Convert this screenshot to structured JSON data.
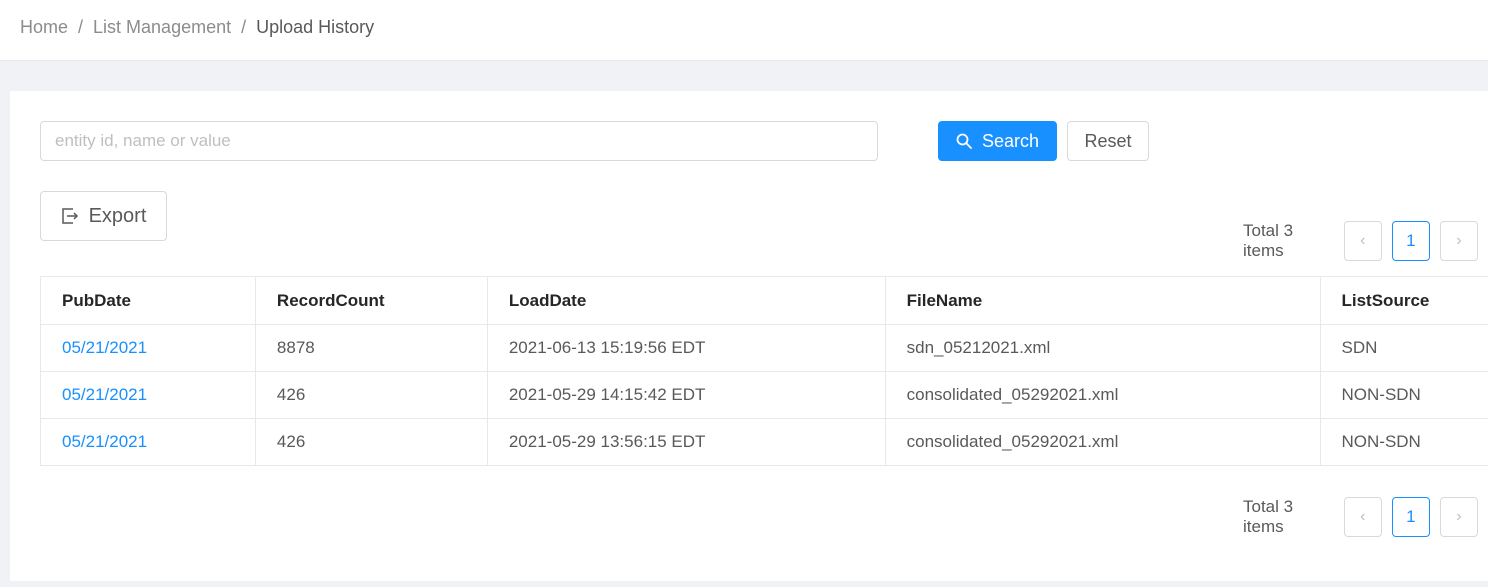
{
  "breadcrumb": {
    "home": "Home",
    "separator": "/",
    "list_management": "List Management",
    "current": "Upload History"
  },
  "search": {
    "placeholder": "entity id, name or value",
    "value": "",
    "search_label": "Search",
    "reset_label": "Reset"
  },
  "toolbar": {
    "export_label": "Export"
  },
  "pagination": {
    "total_text": "Total 3 items",
    "prev_icon": "‹",
    "next_icon": "›",
    "current_page": "1"
  },
  "table": {
    "columns": [
      "PubDate",
      "RecordCount",
      "LoadDate",
      "FileName",
      "ListSource"
    ],
    "rows": [
      [
        "05/21/2021",
        "8878",
        "2021-06-13 15:19:56 EDT",
        "sdn_05212021.xml",
        "SDN"
      ],
      [
        "05/21/2021",
        "426",
        "2021-05-29 14:15:42 EDT",
        "consolidated_05292021.xml",
        "NON-SDN"
      ],
      [
        "05/21/2021",
        "426",
        "2021-05-29 13:56:15 EDT",
        "consolidated_05292021.xml",
        "NON-SDN"
      ]
    ]
  },
  "colors": {
    "primary": "#1890ff",
    "background": "#f0f2f5",
    "border": "#d9d9d9"
  }
}
